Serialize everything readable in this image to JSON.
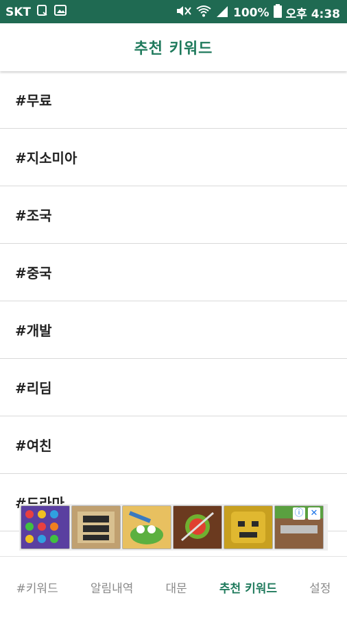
{
  "status_bar": {
    "carrier": "SKT",
    "battery": "100%",
    "time": "오후 4:38"
  },
  "header": {
    "title": "추천 키워드"
  },
  "keywords": [
    {
      "label": "#무료"
    },
    {
      "label": "#지소미아"
    },
    {
      "label": "#조국"
    },
    {
      "label": "#중국"
    },
    {
      "label": "#개발"
    },
    {
      "label": "#리딤"
    },
    {
      "label": "#여친"
    },
    {
      "label": "#드라마"
    }
  ],
  "ad": {
    "thumbs": [
      {
        "icon": "candy-game-icon",
        "color": "#5a3fa0"
      },
      {
        "icon": "gta-game-icon",
        "color": "#c0a070"
      },
      {
        "icon": "crocodile-game-icon",
        "color": "#e8c060"
      },
      {
        "icon": "fruit-ninja-icon",
        "color": "#6b3a1f"
      },
      {
        "icon": "temple-run-icon",
        "color": "#c8a020"
      },
      {
        "icon": "minecraft-icon",
        "color": "#7a5a3a"
      }
    ]
  },
  "bottom_nav": {
    "items": [
      {
        "label": "#키워드",
        "active": false
      },
      {
        "label": "알림내역",
        "active": false
      },
      {
        "label": "대문",
        "active": false
      },
      {
        "label": "추천 키워드",
        "active": true
      },
      {
        "label": "설정",
        "active": false
      }
    ]
  },
  "colors": {
    "status_bg": "#1f6a52",
    "accent": "#1f7a5c"
  }
}
